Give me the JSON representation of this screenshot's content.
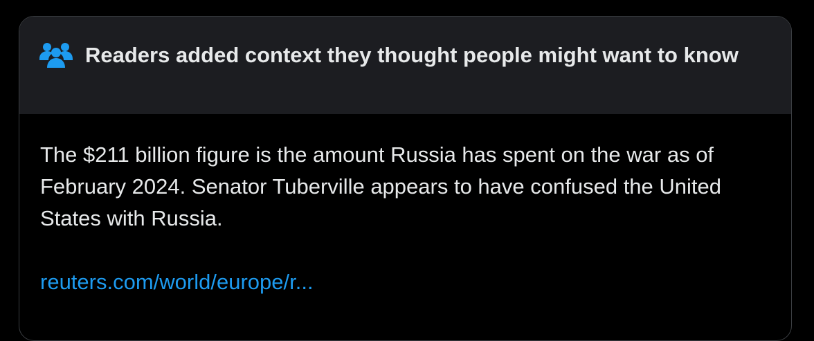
{
  "note": {
    "header_icon": "people-icon",
    "header_title": "Readers added context they thought people might want to know",
    "body_text": "The $211 billion figure is the amount Russia has spent on the war as of February 2024. Senator Tuberville appears to have confused the United States with Russia.",
    "source_link": "reuters.com/world/europe/r..."
  },
  "colors": {
    "page_background": "#000000",
    "header_background": "#1c1d21",
    "border": "#3a3d41",
    "text": "#e7e9ea",
    "link": "#1d9bf0",
    "icon": "#1d9bf0"
  }
}
